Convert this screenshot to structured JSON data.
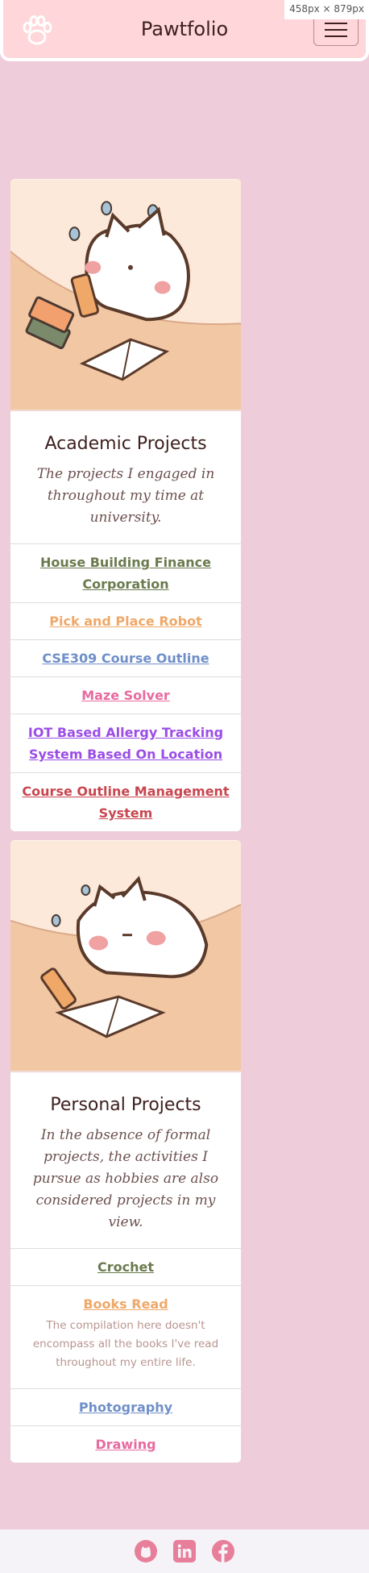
{
  "screen_badge": "458px × 879px",
  "navbar": {
    "brand": "Pawtfolio",
    "logo_icon": "paw-icon",
    "menu_icon": "hamburger-icon"
  },
  "cards": [
    {
      "title": "Academic Projects",
      "subtitle": "The projects I engaged in throughout my time at university.",
      "items": [
        {
          "label": "House Building Finance Corporation",
          "color": "#6b7a4e"
        },
        {
          "label": "Pick and Place Robot",
          "color": "#f0a868"
        },
        {
          "label": "CSE309 Course Outline",
          "color": "#6f8fc9"
        },
        {
          "label": "Maze Solver",
          "color": "#e86aa0"
        },
        {
          "label": "IOT Based Allergy Tracking System Based On Location",
          "color": "#9b4de6"
        },
        {
          "label": "Course Outline Management System",
          "color": "#c8464f"
        }
      ]
    },
    {
      "title": "Personal Projects",
      "subtitle": "In the absence of formal projects, the activities I pursue as hobbies are also considered projects in my view.",
      "items": [
        {
          "label": "Crochet",
          "color": "#6b7a4e"
        },
        {
          "label": "Books Read",
          "color": "#f0a868",
          "note": "The compilation here doesn't encompass all the books I've read throughout my entire life."
        },
        {
          "label": "Photography",
          "color": "#6f8fc9"
        },
        {
          "label": "Drawing",
          "color": "#e86aa0"
        }
      ]
    }
  ],
  "footer": {
    "icons": [
      "github-icon",
      "linkedin-icon",
      "facebook-icon"
    ],
    "icon_color": "#e87f9a"
  },
  "colors": {
    "page_bg": "#efccd9",
    "navbar_bg": "#ffd6d9",
    "title_text": "#3d1f1f",
    "subtitle_text": "#6d5050"
  }
}
